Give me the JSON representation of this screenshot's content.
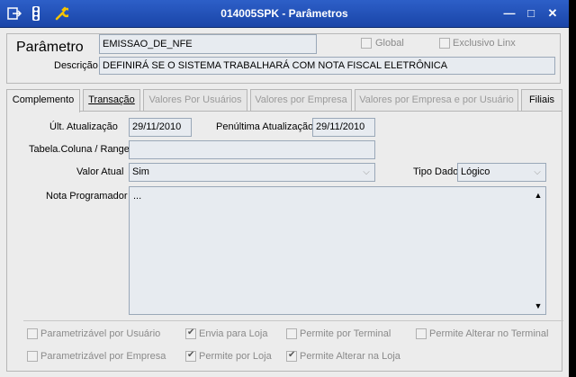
{
  "window": {
    "title": "014005SPK - Parâmetros",
    "minimize": "―",
    "maximize": "□",
    "close": "✕"
  },
  "toolbar_icons": [
    "export-icon",
    "traffic-light-icon",
    "wrench-icon"
  ],
  "parametro": {
    "label": "Parâmetro",
    "value": "EMISSAO_DE_NFE",
    "global_label": "Global",
    "exclusivo_label": "Exclusivo Linx",
    "descricao_label": "Descrição",
    "descricao_value": "DEFINIRÁ SE O SISTEMA TRABALHARÁ COM NOTA FISCAL ELETRÔNICA"
  },
  "tabs": [
    {
      "label": "Complemento",
      "state": "active"
    },
    {
      "label": "Transação",
      "state": "enabled"
    },
    {
      "label": "Valores Por Usuários",
      "state": "disabled"
    },
    {
      "label": "Valores por Empresa",
      "state": "disabled"
    },
    {
      "label": "Valores por Empresa e por Usuário",
      "state": "disabled"
    },
    {
      "label": "Filiais",
      "state": "enabled"
    }
  ],
  "complemento": {
    "ult_atualizacao_label": "Últ. Atualização",
    "ult_atualizacao_value": "29/11/2010",
    "penultima_label": "Penúltima Atualização",
    "penultima_value": "29/11/2010",
    "tabela_label": "Tabela.Coluna / Range",
    "tabela_value": "",
    "valor_atual_label": "Valor Atual",
    "valor_atual_value": "Sim",
    "tipo_dado_label": "Tipo Dado",
    "tipo_dado_value": "Lógico",
    "nota_label": "Nota Programador",
    "nota_value": "..."
  },
  "options": [
    {
      "label": "Parametrizável por Usuário",
      "checked": false
    },
    {
      "label": "Envia para Loja",
      "checked": true
    },
    {
      "label": "Permite por Terminal",
      "checked": false
    },
    {
      "label": "Permite Alterar no Terminal",
      "checked": false
    },
    {
      "label": "Parametrizável por Empresa",
      "checked": false
    },
    {
      "label": "Permite por Loja",
      "checked": true
    },
    {
      "label": "Permite Alterar na Loja",
      "checked": true
    }
  ],
  "colors": {
    "titlebar": "#2d5fc8",
    "window_bg": "#ececec",
    "field_bg": "#e7ebf0"
  }
}
